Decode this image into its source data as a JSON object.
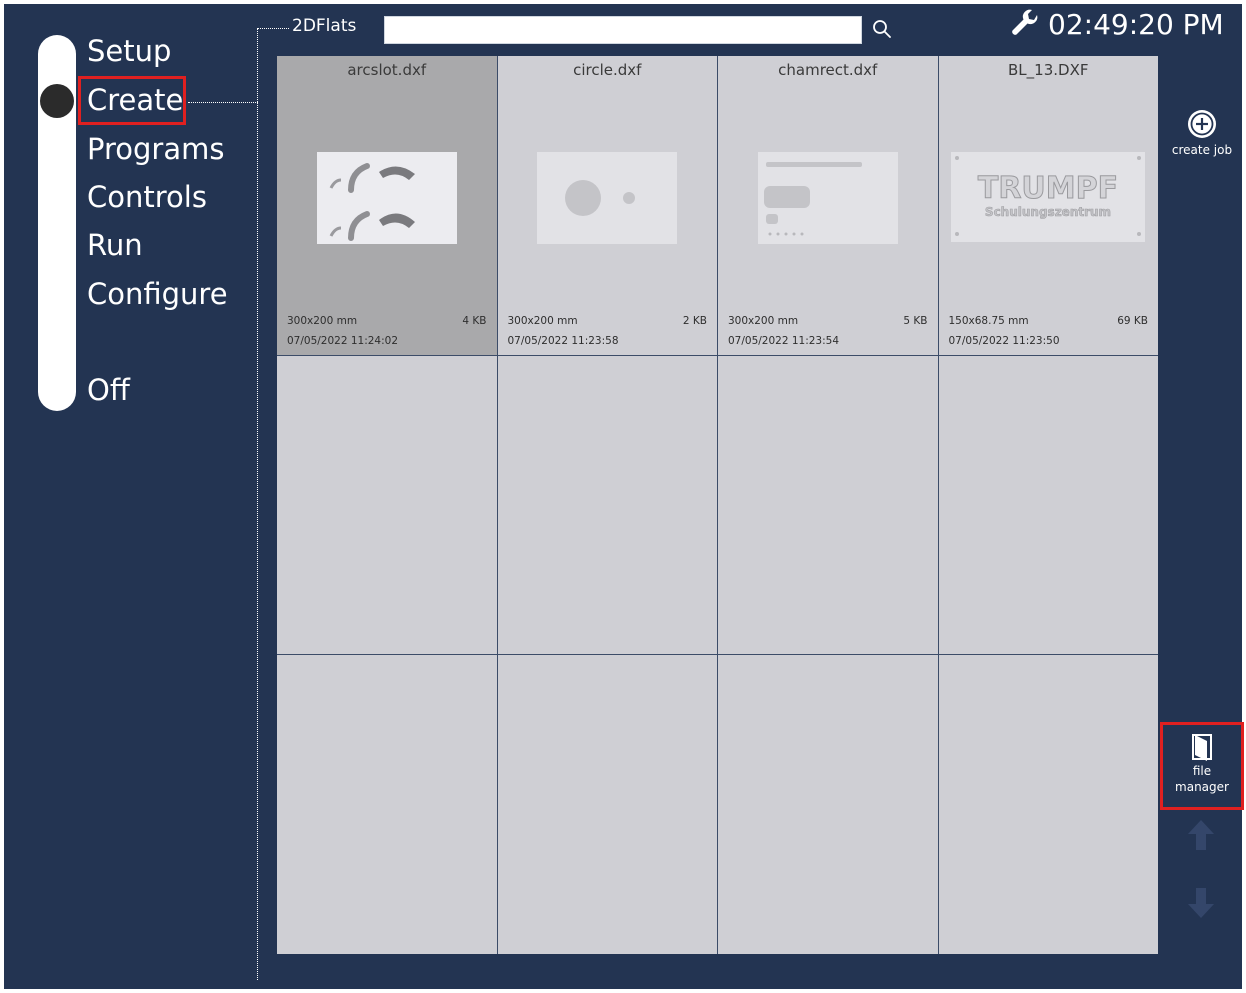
{
  "nav": {
    "items": [
      {
        "label": "Setup"
      },
      {
        "label": "Create"
      },
      {
        "label": "Programs"
      },
      {
        "label": "Controls"
      },
      {
        "label": "Run"
      },
      {
        "label": "Configure"
      },
      {
        "label": "Off"
      }
    ],
    "selected": "Create"
  },
  "header": {
    "folder": "2DFlats",
    "search": {
      "value": "",
      "placeholder": ""
    },
    "clock_icon": "wrench-icon",
    "time": "02:49:20 PM"
  },
  "files": [
    {
      "name": "arcslot.dxf",
      "dimensions": "300x200 mm",
      "size": "4 KB",
      "date": "07/05/2022 11:24:02",
      "selected": true
    },
    {
      "name": "circle.dxf",
      "dimensions": "300x200 mm",
      "size": "2 KB",
      "date": "07/05/2022 11:23:58",
      "selected": false
    },
    {
      "name": "chamrect.dxf",
      "dimensions": "300x200 mm",
      "size": "5 KB",
      "date": "07/05/2022 11:23:54",
      "selected": false
    },
    {
      "name": "BL_13.DXF",
      "dimensions": "150x68.75 mm",
      "size": "69 KB",
      "date": "07/05/2022 11:23:50",
      "selected": false
    }
  ],
  "thumbnail_text": {
    "brand": "TRUMPF",
    "subtitle": "Schulungszentrum"
  },
  "actions": {
    "create_job": {
      "label": "create job",
      "icon": "plus-circle-icon"
    },
    "file_manager": {
      "label_line1": "file",
      "label_line2": "manager",
      "icon": "door-icon"
    },
    "scroll_up": {
      "icon": "arrow-up-icon"
    },
    "scroll_down": {
      "icon": "arrow-down-icon"
    }
  },
  "colors": {
    "background": "#233452",
    "highlight": "#e02020",
    "tile": "#cfcfd4",
    "tile_selected": "#a9a9ab"
  }
}
